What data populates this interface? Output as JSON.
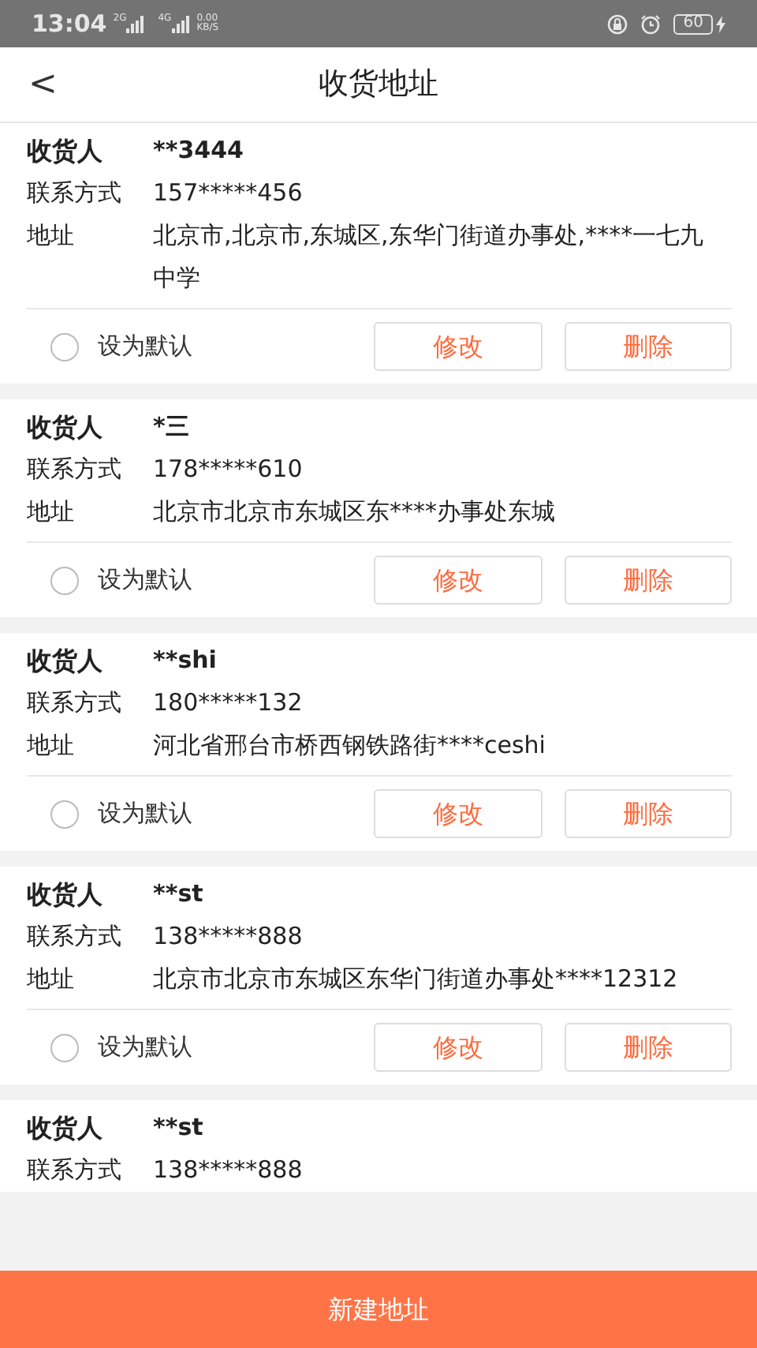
{
  "status_bar": {
    "time": "13:04",
    "network_1": "2G",
    "network_2": "4G",
    "speed": "0.00",
    "speed_unit": "KB/S",
    "battery": "60"
  },
  "header": {
    "back": "<",
    "title": "收货地址"
  },
  "addresses": [
    {
      "name_label": "收货人",
      "name": "**3444",
      "phone_label": "联系方式",
      "phone": "157*****456",
      "address_label": "地址",
      "address": "北京市,北京市,东城区,东华门街道办事处,****一七九中学",
      "default_label": "设为默认",
      "default": false,
      "edit": "修改",
      "delete": "删除"
    },
    {
      "name_label": "收货人",
      "name": "*三",
      "phone_label": "联系方式",
      "phone": "178*****610",
      "address_label": "地址",
      "address": "北京市北京市东城区东****办事处东城",
      "default_label": "设为默认",
      "default": false,
      "edit": "修改",
      "delete": "删除"
    },
    {
      "name_label": "收货人",
      "name": "**shi",
      "phone_label": "联系方式",
      "phone": "180*****132",
      "address_label": "地址",
      "address": "河北省邢台市桥西钢铁路街****ceshi",
      "default_label": "设为默认",
      "default": false,
      "edit": "修改",
      "delete": "删除"
    },
    {
      "name_label": "收货人",
      "name": "**st",
      "phone_label": "联系方式",
      "phone": "138*****888",
      "address_label": "地址",
      "address": "北京市北京市东城区东华门街道办事处****12312",
      "default_label": "设为默认",
      "default": false,
      "edit": "修改",
      "delete": "删除"
    },
    {
      "name_label": "收货人",
      "name": "**st",
      "phone_label": "联系方式",
      "phone": "138*****888"
    }
  ],
  "new_button": "新建地址"
}
